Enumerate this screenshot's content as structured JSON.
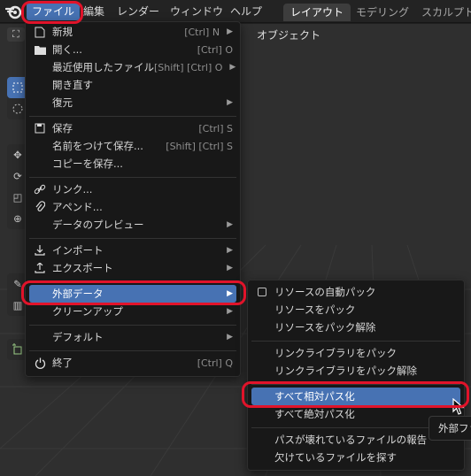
{
  "menubar": {
    "items": [
      "ファイル",
      "編集",
      "レンダー",
      "ウィンドウ",
      "ヘルプ"
    ],
    "workspaces": [
      "レイアウト",
      "モデリング",
      "スカルプト"
    ]
  },
  "viewport": {
    "object_label": "オブジェクト"
  },
  "file_menu": {
    "items": [
      {
        "label": "新規",
        "shortcut": "[Ctrl] N",
        "icon": "new-file-icon"
      },
      {
        "label": "開く...",
        "shortcut": "[Ctrl] O",
        "icon": "folder-icon"
      },
      {
        "label": "最近使用したファイル",
        "shortcut": "[Shift] [Ctrl] O",
        "icon": "submenu-arrow"
      },
      {
        "label": "開き直す",
        "shortcut": ""
      },
      {
        "label": "復元",
        "shortcut": "",
        "icon": "submenu-arrow"
      },
      {
        "label": "保存",
        "shortcut": "[Ctrl] S",
        "icon": "save-icon"
      },
      {
        "label": "名前をつけて保存...",
        "shortcut": "[Shift] [Ctrl] S"
      },
      {
        "label": "コピーを保存...",
        "shortcut": ""
      },
      {
        "label": "リンク...",
        "shortcut": "",
        "icon": "link-icon"
      },
      {
        "label": "アペンド...",
        "shortcut": "",
        "icon": "paperclip-icon"
      },
      {
        "label": "データのプレビュー",
        "shortcut": "",
        "icon": "submenu-arrow"
      },
      {
        "label": "インポート",
        "shortcut": "",
        "icon": "import-icon"
      },
      {
        "label": "エクスポート",
        "shortcut": "",
        "icon": "export-icon"
      },
      {
        "label": "外部データ",
        "shortcut": "",
        "icon": "submenu-arrow"
      },
      {
        "label": "クリーンアップ",
        "shortcut": "",
        "icon": "submenu-arrow"
      },
      {
        "label": "デフォルト",
        "shortcut": "",
        "icon": "submenu-arrow"
      },
      {
        "label": "終了",
        "shortcut": "[Ctrl] Q",
        "icon": "power-icon"
      }
    ]
  },
  "external_menu": {
    "items": [
      {
        "label": "リソースの自動パック",
        "checkbox": true,
        "checked": false
      },
      {
        "label": "リソースをパック"
      },
      {
        "label": "リソースをパック解除"
      },
      {
        "label": "リンクライブラリをパック"
      },
      {
        "label": "リンクライブラリをパック解除"
      },
      {
        "label": "すべて相対パス化"
      },
      {
        "label": "すべて絶対パス化"
      },
      {
        "label": "パスが壊れているファイルの報告"
      },
      {
        "label": "欠けているファイルを探す"
      }
    ]
  },
  "tooltip": {
    "text": "外部ファ"
  },
  "colors": {
    "highlight": "#4772b3",
    "annotation": "#e1132a",
    "menu_bg": "#181818"
  }
}
